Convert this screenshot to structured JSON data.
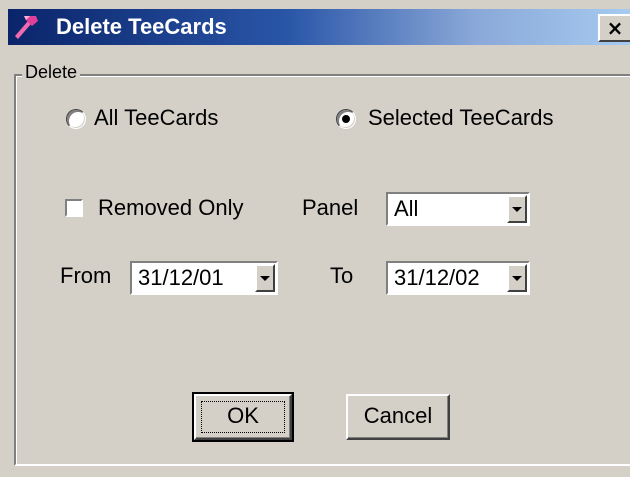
{
  "window": {
    "title": "Delete TeeCards",
    "close_glyph": "×"
  },
  "group": {
    "legend": "Delete"
  },
  "scope": {
    "all_label": "All TeeCards",
    "all_selected": false,
    "selected_label": "Selected TeeCards",
    "selected_selected": true
  },
  "filters": {
    "removed_only_label": "Removed Only",
    "removed_only_checked": false,
    "panel_label": "Panel",
    "panel_value": "All"
  },
  "dates": {
    "from_label": "From",
    "from_value": "31/12/01",
    "to_label": "To",
    "to_value": "31/12/02"
  },
  "buttons": {
    "ok_label": "OK",
    "cancel_label": "Cancel"
  },
  "icons": {
    "app": "hammer-icon",
    "close": "close-icon",
    "dropdown": "chevron-down-icon"
  },
  "colors": {
    "titlebar_start": "#0a246a",
    "titlebar_end": "#a6caf0",
    "face": "#d4d0c8",
    "app_icon": "#e0409a"
  }
}
